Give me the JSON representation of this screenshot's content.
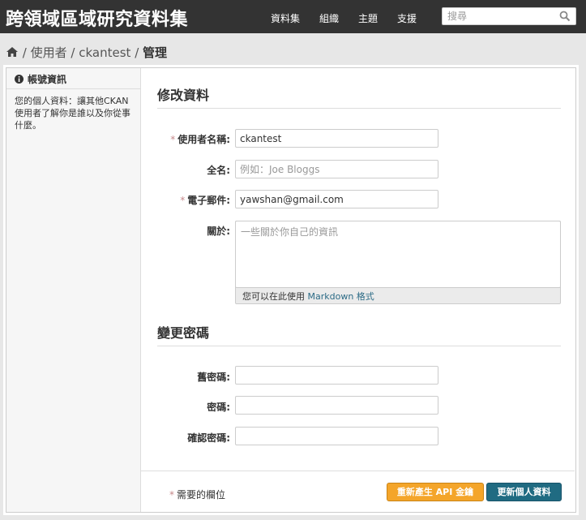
{
  "site": {
    "title": "跨領域區域研究資料集"
  },
  "nav": {
    "items": [
      "資料集",
      "組織",
      "主題",
      "支援"
    ]
  },
  "search": {
    "placeholder": "搜尋"
  },
  "breadcrumb": {
    "items": [
      "使用者",
      "ckantest"
    ],
    "active": "管理"
  },
  "sidebar": {
    "heading": "帳號資訊",
    "body": "您的個人資料：讓其他CKAN使用者了解你是誰以及你從事什麼。"
  },
  "edit": {
    "title": "修改資料",
    "username": {
      "label": "使用者名稱:",
      "value": "ckantest"
    },
    "fullname": {
      "label": "全名:",
      "placeholder": "例如：Joe Bloggs"
    },
    "email": {
      "label": "電子郵件:",
      "value": "yawshan@gmail.com"
    },
    "about": {
      "label": "關於:",
      "placeholder": "一些關於你自己的資訊",
      "help_prefix": "您可以在此使用",
      "help_link": "Markdown 格式"
    }
  },
  "password": {
    "title": "變更密碼",
    "old_label": "舊密碼:",
    "new_label": "密碼:",
    "confirm_label": "確認密碼:"
  },
  "actions": {
    "required_note": "需要的欄位",
    "required_mark": "*",
    "regenerate_label": "重新產生 API 金鑰",
    "update_label": "更新個人資料"
  }
}
